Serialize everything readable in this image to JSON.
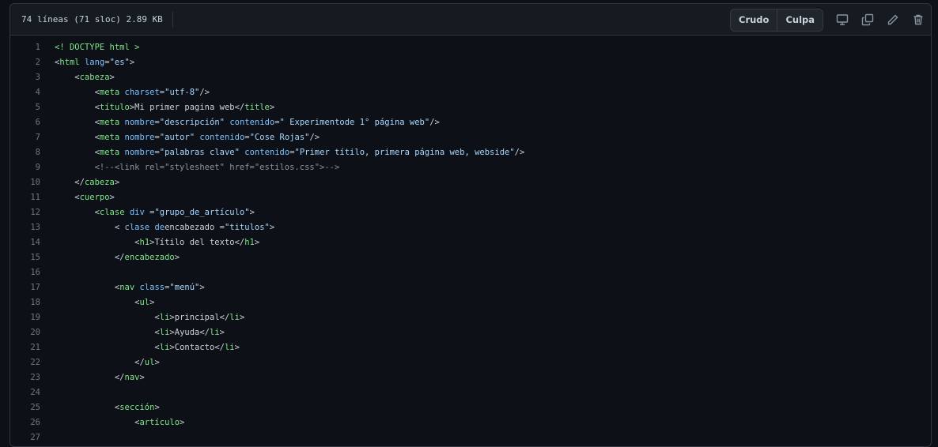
{
  "header": {
    "file_info": "74 líneas (71 sloc) 2.89 KB",
    "raw_label": "Crudo",
    "blame_label": "Culpa"
  },
  "icons": {
    "display": "desktop-icon",
    "copy": "copy-icon",
    "edit": "pencil-icon",
    "delete": "trash-icon"
  },
  "colors": {
    "tag": "#7ee787",
    "attr": "#79c0ff",
    "string": "#a5d6ff",
    "comment": "#8b949e",
    "text": "#c9d1d9"
  },
  "code": {
    "lines": [
      {
        "n": "1",
        "parts": [
          [
            "t",
            "<! DOCTYPE html >"
          ]
        ]
      },
      {
        "n": "2",
        "parts": [
          [
            "p",
            "<"
          ],
          [
            "t",
            "html"
          ],
          [
            "p",
            " "
          ],
          [
            "a",
            "lang"
          ],
          [
            "p",
            "="
          ],
          [
            "s",
            "\"es\""
          ],
          [
            "p",
            ">"
          ]
        ]
      },
      {
        "n": "3",
        "parts": [
          [
            "p",
            "    <"
          ],
          [
            "t",
            "cabeza"
          ],
          [
            "p",
            ">"
          ]
        ]
      },
      {
        "n": "4",
        "parts": [
          [
            "p",
            "        <"
          ],
          [
            "t",
            "meta"
          ],
          [
            "p",
            " "
          ],
          [
            "a",
            "charset"
          ],
          [
            "p",
            "="
          ],
          [
            "s",
            "\"utf-8\""
          ],
          [
            "p",
            "/>"
          ]
        ]
      },
      {
        "n": "5",
        "parts": [
          [
            "p",
            "        <"
          ],
          [
            "t",
            "título"
          ],
          [
            "p",
            ">Mi primer pagina web</"
          ],
          [
            "t",
            "title"
          ],
          [
            "p",
            ">"
          ]
        ]
      },
      {
        "n": "6",
        "parts": [
          [
            "p",
            "        <"
          ],
          [
            "t",
            "meta"
          ],
          [
            "p",
            " "
          ],
          [
            "a",
            "nombre"
          ],
          [
            "p",
            "="
          ],
          [
            "s",
            "\"descripción\""
          ],
          [
            "p",
            " "
          ],
          [
            "a",
            "contenido"
          ],
          [
            "p",
            "="
          ],
          [
            "s",
            "\" Experimentode 1° página web\""
          ],
          [
            "p",
            "/>"
          ]
        ]
      },
      {
        "n": "7",
        "parts": [
          [
            "p",
            "        <"
          ],
          [
            "t",
            "meta"
          ],
          [
            "p",
            " "
          ],
          [
            "a",
            "nombre"
          ],
          [
            "p",
            "="
          ],
          [
            "s",
            "\"autor\""
          ],
          [
            "p",
            " "
          ],
          [
            "a",
            "contenido"
          ],
          [
            "p",
            "="
          ],
          [
            "s",
            "\"Cose Rojas\""
          ],
          [
            "p",
            "/>"
          ]
        ]
      },
      {
        "n": "8",
        "parts": [
          [
            "p",
            "        <"
          ],
          [
            "t",
            "meta"
          ],
          [
            "p",
            " "
          ],
          [
            "a",
            "nombre"
          ],
          [
            "p",
            "="
          ],
          [
            "s",
            "\"palabras clave\""
          ],
          [
            "p",
            " "
          ],
          [
            "a",
            "contenido"
          ],
          [
            "p",
            "="
          ],
          [
            "s",
            "\"Primer títilo, primera página web, webside\""
          ],
          [
            "p",
            "/>"
          ]
        ]
      },
      {
        "n": "9",
        "parts": [
          [
            "c",
            "        <!--<link rel=\"stylesheet\" href=\"estilos.css\">-->"
          ]
        ]
      },
      {
        "n": "10",
        "parts": [
          [
            "p",
            "    </"
          ],
          [
            "t",
            "cabeza"
          ],
          [
            "p",
            ">"
          ]
        ]
      },
      {
        "n": "11",
        "parts": [
          [
            "p",
            "    <"
          ],
          [
            "t",
            "cuerpo"
          ],
          [
            "p",
            ">"
          ]
        ]
      },
      {
        "n": "12",
        "parts": [
          [
            "p",
            "        <"
          ],
          [
            "t",
            "clase"
          ],
          [
            "p",
            " "
          ],
          [
            "a",
            "div"
          ],
          [
            "p",
            " ="
          ],
          [
            "s",
            "\"grupo_de_artículo\""
          ],
          [
            "p",
            ">"
          ]
        ]
      },
      {
        "n": "13",
        "parts": [
          [
            "p",
            "            < "
          ],
          [
            "a",
            "clase"
          ],
          [
            "p",
            " "
          ],
          [
            "a",
            "de"
          ],
          [
            "p",
            "encabezado ="
          ],
          [
            "s",
            "\"titulos\""
          ],
          [
            "p",
            ">"
          ]
        ]
      },
      {
        "n": "14",
        "parts": [
          [
            "p",
            "                <"
          ],
          [
            "t",
            "h1"
          ],
          [
            "p",
            ">Títilo del texto</"
          ],
          [
            "t",
            "h1"
          ],
          [
            "p",
            ">"
          ]
        ]
      },
      {
        "n": "15",
        "parts": [
          [
            "p",
            "            </"
          ],
          [
            "t",
            "encabezado"
          ],
          [
            "p",
            ">"
          ]
        ]
      },
      {
        "n": "16",
        "parts": [
          [
            "p",
            ""
          ]
        ]
      },
      {
        "n": "17",
        "parts": [
          [
            "p",
            "            <"
          ],
          [
            "t",
            "nav"
          ],
          [
            "p",
            " "
          ],
          [
            "a",
            "class"
          ],
          [
            "p",
            "="
          ],
          [
            "s",
            "\"menú\""
          ],
          [
            "p",
            ">"
          ]
        ]
      },
      {
        "n": "18",
        "parts": [
          [
            "p",
            "                <"
          ],
          [
            "t",
            "ul"
          ],
          [
            "p",
            ">"
          ]
        ]
      },
      {
        "n": "19",
        "parts": [
          [
            "p",
            "                    <"
          ],
          [
            "t",
            "li"
          ],
          [
            "p",
            ">principal</"
          ],
          [
            "t",
            "li"
          ],
          [
            "p",
            ">"
          ]
        ]
      },
      {
        "n": "20",
        "parts": [
          [
            "p",
            "                    <"
          ],
          [
            "t",
            "li"
          ],
          [
            "p",
            ">Ayuda</"
          ],
          [
            "t",
            "li"
          ],
          [
            "p",
            ">"
          ]
        ]
      },
      {
        "n": "21",
        "parts": [
          [
            "p",
            "                    <"
          ],
          [
            "t",
            "li"
          ],
          [
            "p",
            ">Contacto</"
          ],
          [
            "t",
            "li"
          ],
          [
            "p",
            ">"
          ]
        ]
      },
      {
        "n": "22",
        "parts": [
          [
            "p",
            "                </"
          ],
          [
            "t",
            "ul"
          ],
          [
            "p",
            ">"
          ]
        ]
      },
      {
        "n": "23",
        "parts": [
          [
            "p",
            "            </"
          ],
          [
            "t",
            "nav"
          ],
          [
            "p",
            ">"
          ]
        ]
      },
      {
        "n": "24",
        "parts": [
          [
            "p",
            ""
          ]
        ]
      },
      {
        "n": "25",
        "parts": [
          [
            "p",
            "            <"
          ],
          [
            "t",
            "sección"
          ],
          [
            "p",
            ">"
          ]
        ]
      },
      {
        "n": "26",
        "parts": [
          [
            "p",
            "                <"
          ],
          [
            "t",
            "artículo"
          ],
          [
            "p",
            ">"
          ]
        ]
      },
      {
        "n": "27",
        "parts": [
          [
            "p",
            ""
          ]
        ]
      }
    ]
  }
}
